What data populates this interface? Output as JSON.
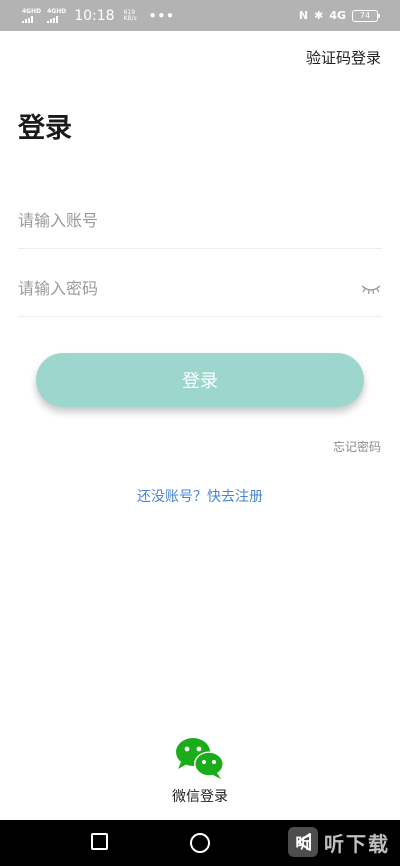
{
  "status_bar": {
    "signal1": "4GHD",
    "signal2": "4GHD",
    "time": "10:18",
    "speed_value": "619",
    "speed_unit": "KB/s",
    "dots": "•••",
    "nfc": "N",
    "bluetooth": "✱",
    "network": "4G",
    "battery": "74"
  },
  "header": {
    "sms_login": "验证码登录",
    "title": "登录"
  },
  "form": {
    "account_placeholder": "请输入账号",
    "password_placeholder": "请输入密码",
    "login_label": "登录",
    "forgot": "忘记密码",
    "register": "还没账号？快去注册"
  },
  "wechat": {
    "label": "微信登录",
    "icon": "wechat-icon",
    "color": "#1aad19"
  },
  "colors": {
    "button": "#9cd6cd",
    "link": "#4a85d0"
  },
  "nav_bar": {
    "watermark_logo": "听",
    "watermark_text": "听下载"
  }
}
